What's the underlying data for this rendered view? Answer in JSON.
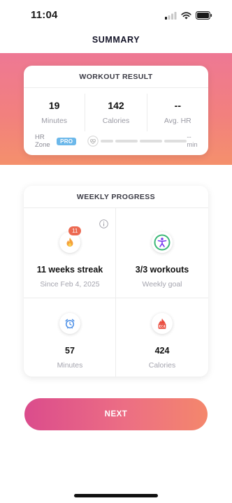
{
  "status_bar": {
    "time": "11:04",
    "icons": [
      "signal-icon",
      "wifi-icon",
      "battery-icon"
    ]
  },
  "nav": {
    "title": "SUMMARY"
  },
  "workout_result": {
    "title": "WORKOUT RESULT",
    "stats": [
      {
        "value": "19",
        "label": "Minutes"
      },
      {
        "value": "142",
        "label": "Calories"
      },
      {
        "value": "--",
        "label": "Avg. HR"
      }
    ],
    "hr_zone": {
      "label": "HR Zone",
      "badge": "PRO",
      "suffix": "-- min",
      "icon": "heart-rate-icon"
    }
  },
  "weekly_progress": {
    "title": "WEEKLY PROGRESS",
    "streak": {
      "badge": "11",
      "value": "11 weeks streak",
      "label": "Since Feb 4, 2025",
      "icon": "flame-icon"
    },
    "workouts": {
      "value": "3/3 workouts",
      "label": "Weekly goal",
      "icon": "person-icon"
    },
    "minutes": {
      "value": "57",
      "label": "Minutes",
      "icon": "alarm-clock-icon"
    },
    "calories": {
      "value": "424",
      "label": "Calories",
      "icon": "kcal-flame-icon"
    },
    "info_icon": "info-icon"
  },
  "next_button": {
    "label": "NEXT"
  },
  "colors": {
    "gradient_top": "#ee7894",
    "gradient_bottom": "#f4906c",
    "pro_badge": "#6cb8ea",
    "streak_badge": "#ec6a52",
    "goal_green": "#3cb878",
    "goal_purple": "#7a3cf0",
    "button_start": "#db4c8c",
    "button_end": "#f4876c"
  }
}
